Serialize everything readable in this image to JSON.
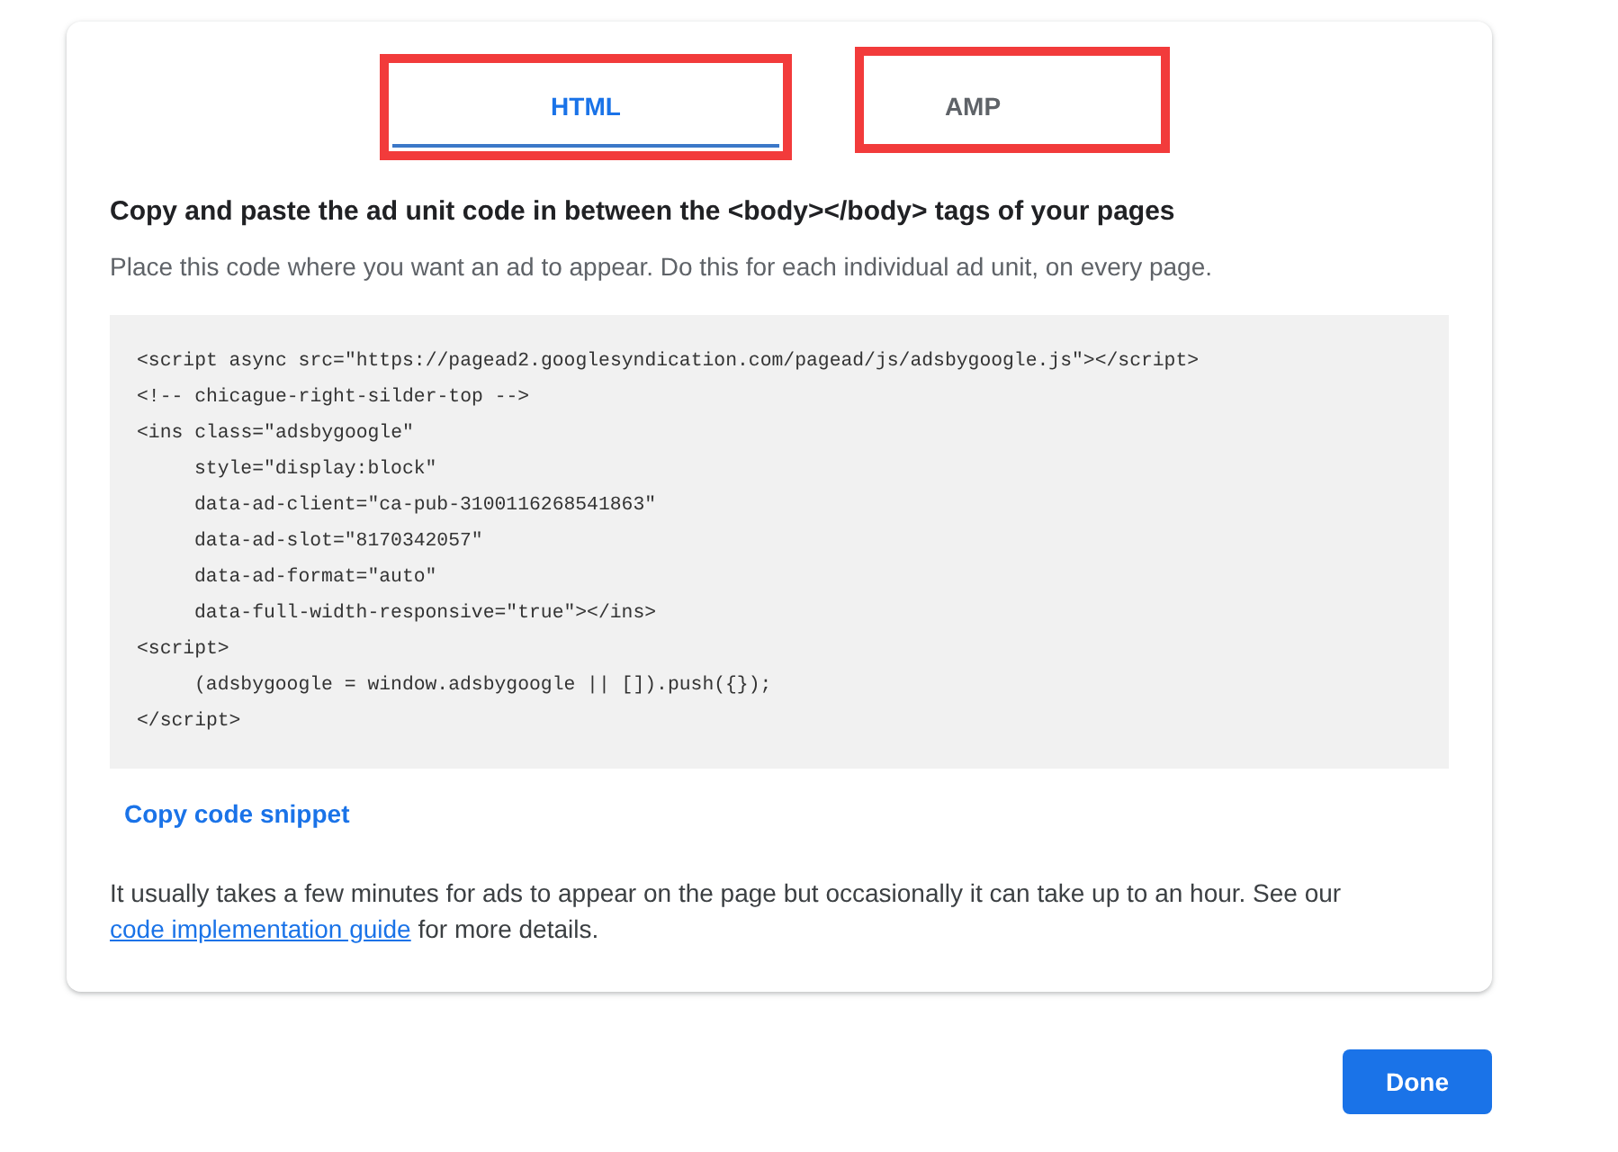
{
  "tabs": [
    {
      "label": "HTML",
      "selected": true,
      "annotated": true
    },
    {
      "label": "AMP",
      "selected": false,
      "annotated": true
    }
  ],
  "heading": "Copy and paste the ad unit code in between the <body></body> tags of your pages",
  "description": "Place this code where you want an ad to appear. Do this for each individual ad unit, on every page.",
  "code_lines": [
    {
      "text": "<script async src=\"https://pagead2.googlesyndication.com/pagead/js/adsbygoogle.js\"></script>"
    },
    {
      "text": "<!-- chicague-right-silder-top -->"
    },
    {
      "text": "<ins class=\"adsbygoogle\"",
      "children": [
        {
          "text": "style=\"display:block\""
        },
        {
          "text": "data-ad-client=\"ca-pub-3100116268541863\""
        },
        {
          "text": "data-ad-slot=\"8170342057\""
        },
        {
          "text": "data-ad-format=\"auto\""
        },
        {
          "text": "data-full-width-responsive=\"true\"></ins>"
        }
      ]
    },
    {
      "text": "<script>",
      "children": [
        {
          "text": "(adsbygoogle = window.adsbygoogle || []).push({});"
        }
      ]
    },
    {
      "text": "</script>"
    }
  ],
  "copy_button": "Copy code snippet",
  "footnote": {
    "before": "It usually takes a few minutes for ads to appear on the page but occasionally it can take up to an hour. See our ",
    "link": "code implementation guide",
    "after": " for more details."
  },
  "done_button": "Done"
}
